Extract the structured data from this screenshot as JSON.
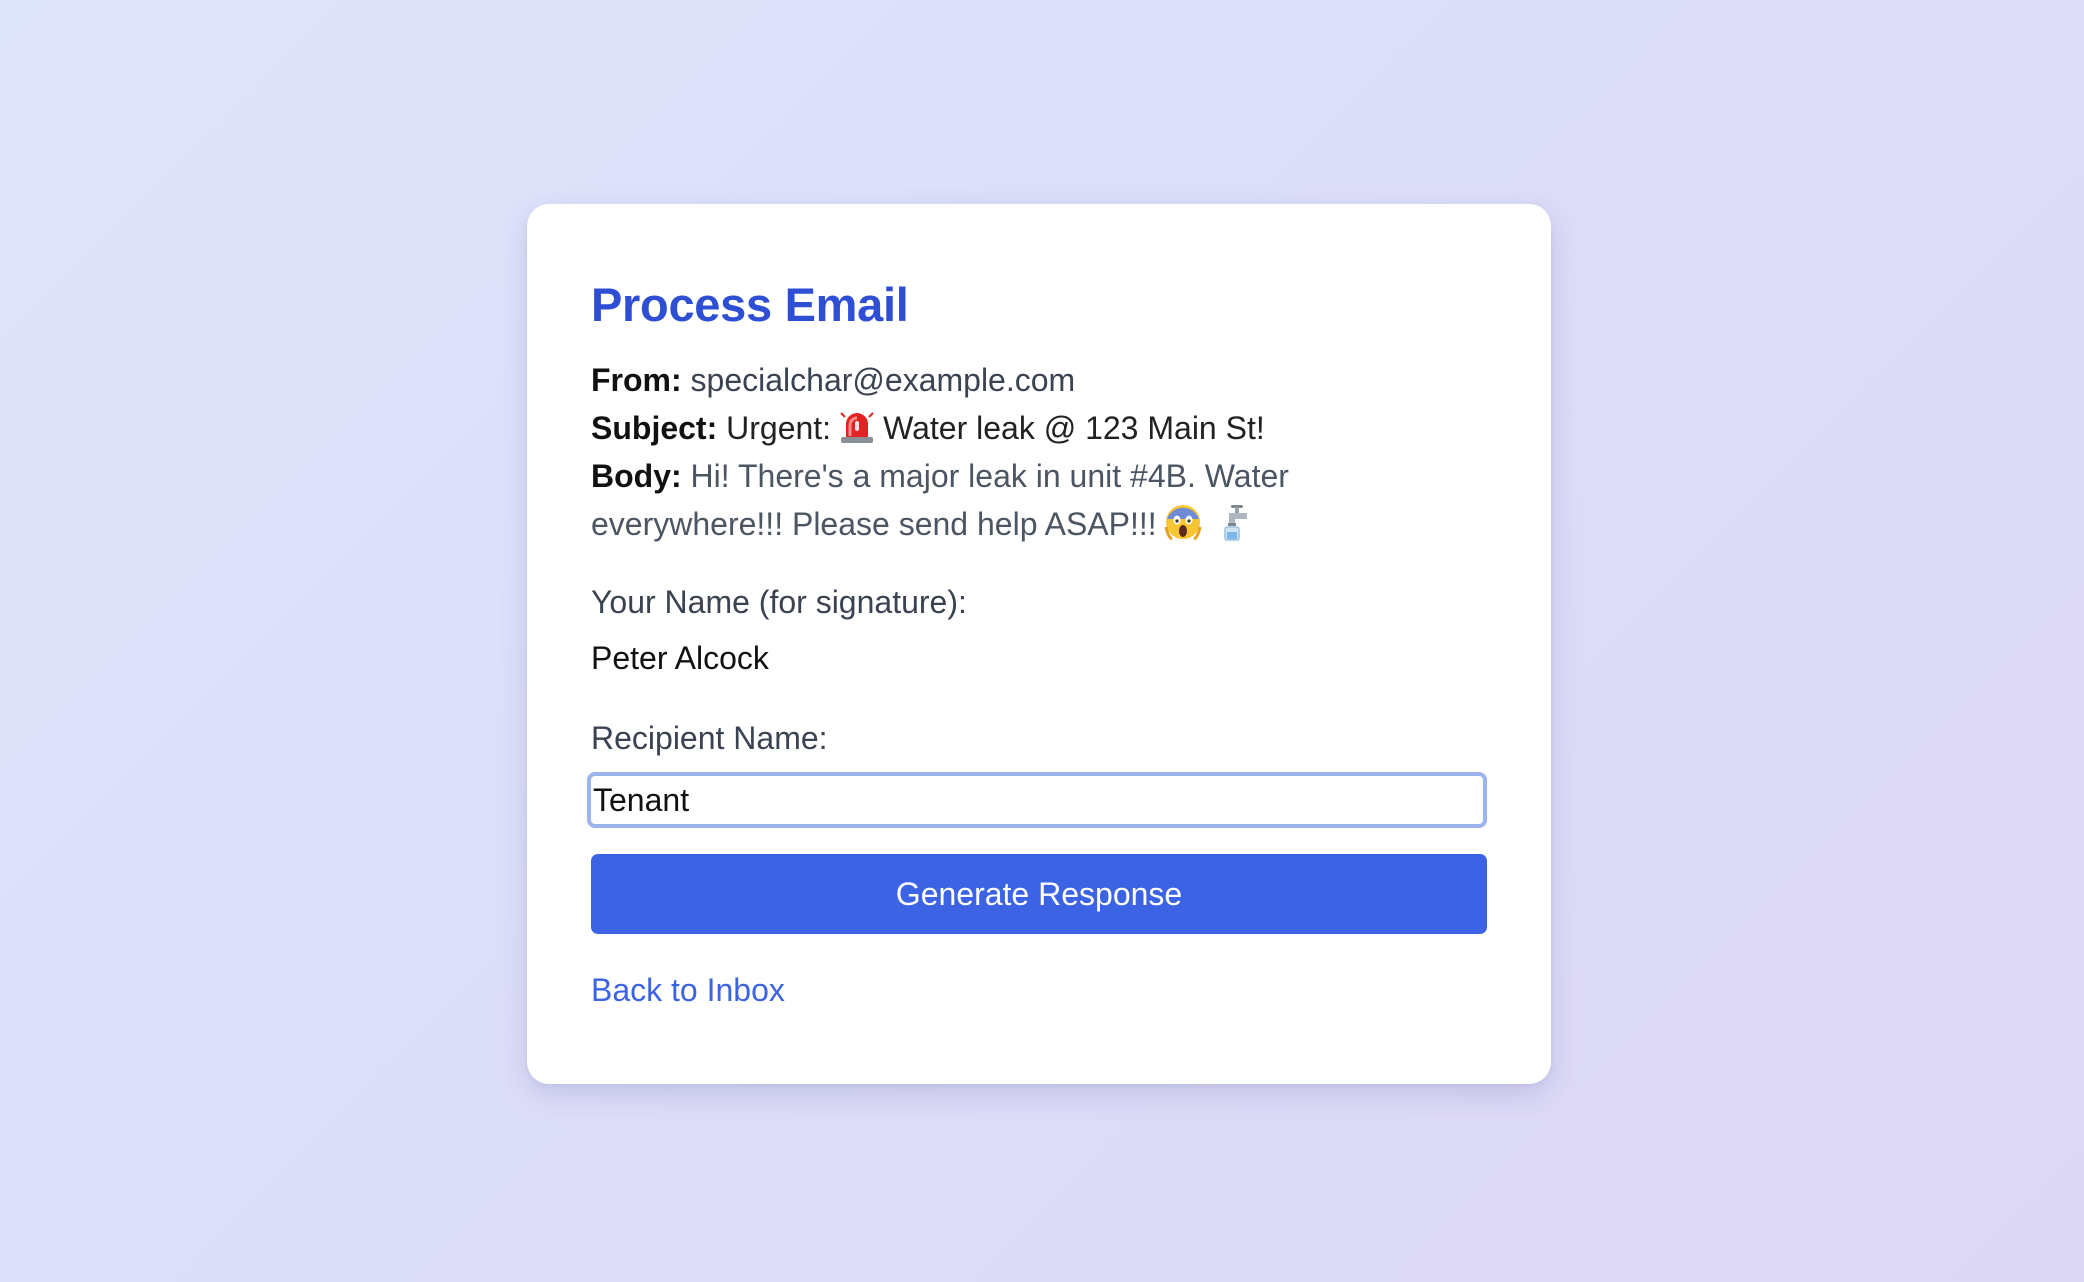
{
  "page": {
    "title": "Process Email"
  },
  "email": {
    "from_label": "From:",
    "from_value": "specialchar@example.com",
    "subject_label": "Subject:",
    "subject_prefix": "Urgent:",
    "subject_text": "Water leak @ 123 Main St!",
    "body_label": "Body:",
    "body_text": "Hi! There's a major leak in unit #4B. Water everywhere!!! Please send help ASAP!!!",
    "icons": [
      "rotating-light-icon",
      "scream-face-icon",
      "faucet-icon"
    ]
  },
  "form": {
    "name_label": "Your Name (for signature):",
    "name_value": "Peter Alcock",
    "recipient_label": "Recipient Name:",
    "recipient_value": "Tenant"
  },
  "actions": {
    "generate_label": "Generate Response",
    "back_label": "Back to Inbox"
  },
  "colors": {
    "accent": "#3b63e3",
    "title": "#2e4fd3",
    "focus_ring": "#9bb5ec"
  }
}
